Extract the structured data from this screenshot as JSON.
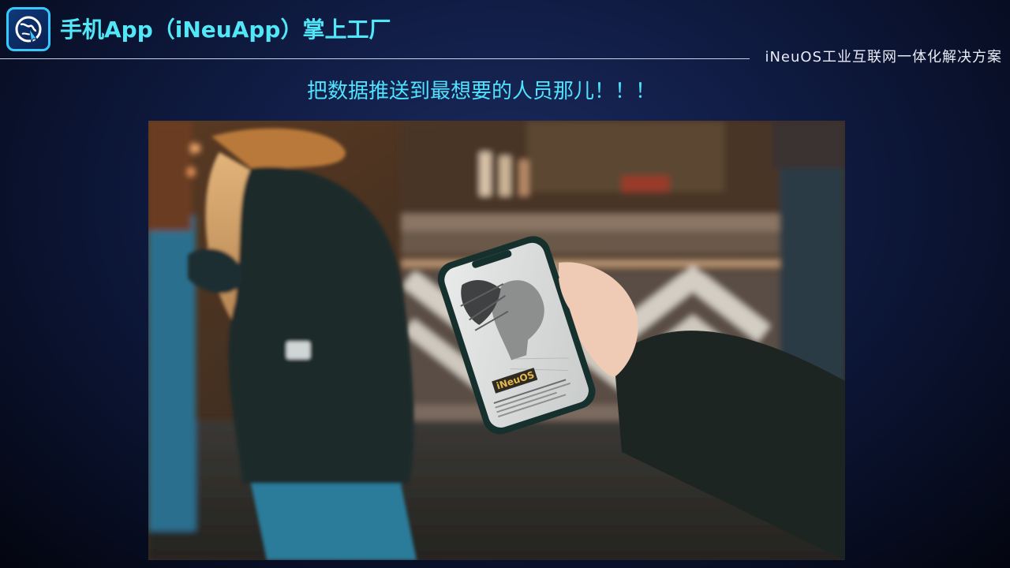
{
  "header": {
    "title": "手机App（iNeuApp）掌上工厂",
    "brand_tag": "iNeuOS工业互联网一体化解决方案",
    "logo_icon": "globe-cursor-icon"
  },
  "main": {
    "headline": "把数据推送到最想要的人员那儿！！！",
    "photo": {
      "phone_logo_text": "iNeuOS"
    }
  },
  "colors": {
    "title": "#52e7f7",
    "headline": "#50e3ff",
    "logo_border": "#35c9ff"
  }
}
